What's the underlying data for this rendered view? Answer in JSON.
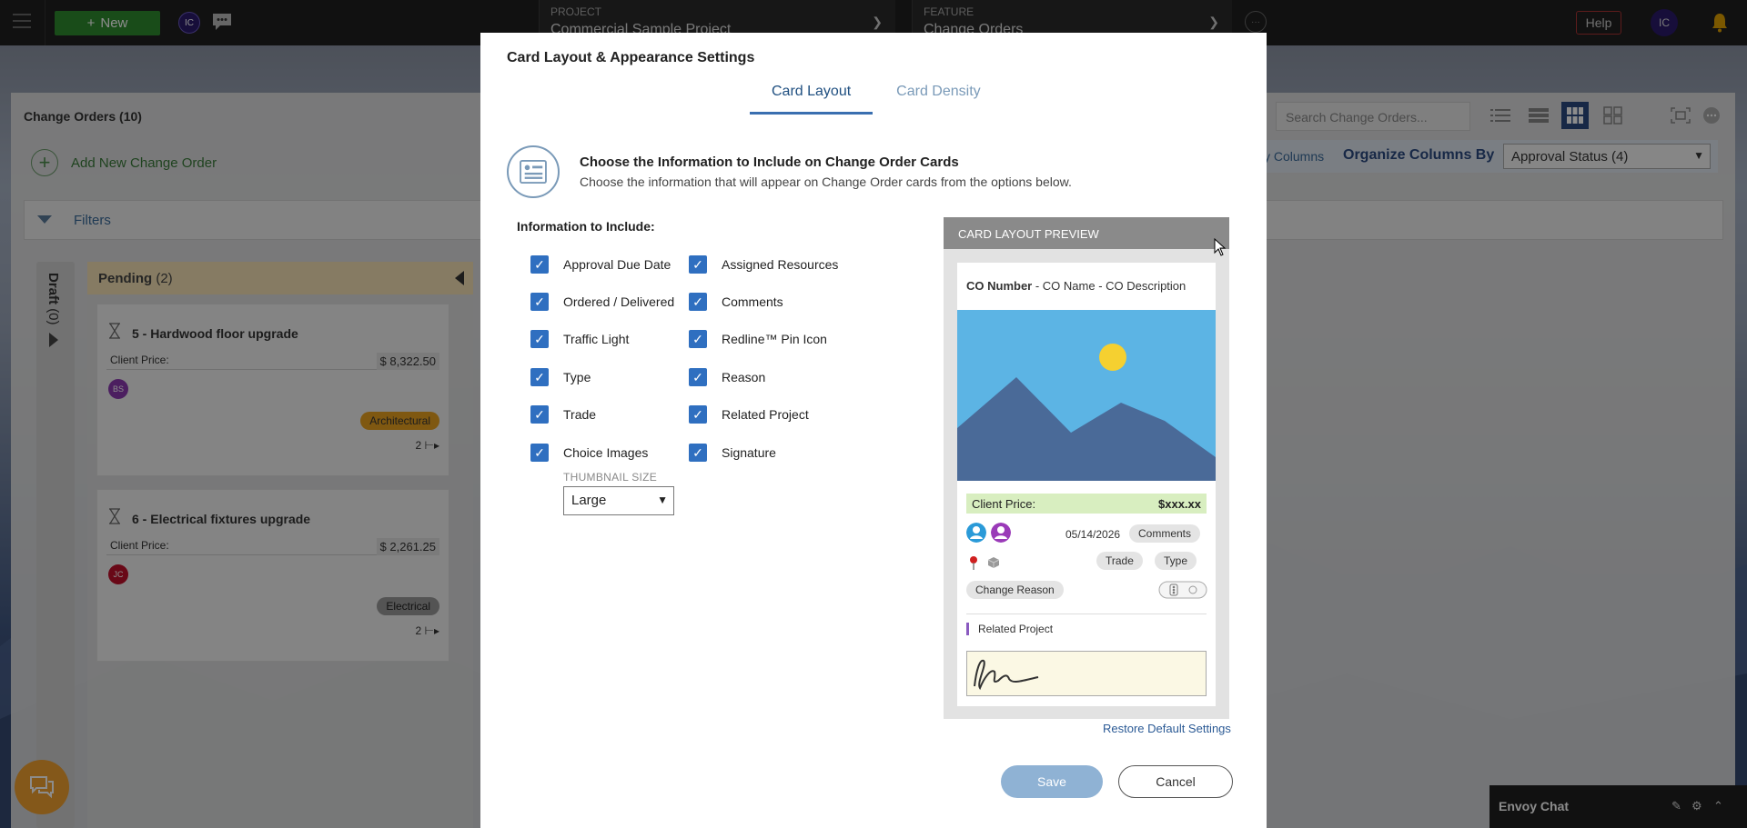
{
  "topbar": {
    "new_label": "New",
    "user_initials": "IC",
    "project": {
      "label": "PROJECT",
      "value": "Commercial Sample Project"
    },
    "feature": {
      "label": "FEATURE",
      "value": "Change Orders"
    },
    "more_label": "···",
    "help_label": "Help",
    "user_initials_right": "IC"
  },
  "main": {
    "title": "Change Orders (10)",
    "add_new_label": "Add New Change Order",
    "filters_label": "Filters",
    "search_placeholder": "Search Change Orders...",
    "quick_columns_label": "ity Columns",
    "organize_label": "Organize Columns By",
    "organize_value": "Approval Status (4)",
    "draft": {
      "name": "Draft",
      "count": "(0)"
    },
    "pending": {
      "name": "Pending",
      "count": "(2)"
    },
    "cards": [
      {
        "title": "5 - Hardwood floor upgrade",
        "price_label": "Client Price:",
        "price": "$ 8,322.50",
        "avatar": "BS",
        "tag": "Architectural",
        "count": "2"
      },
      {
        "title": "6 - Electrical fixtures upgrade",
        "price_label": "Client Price:",
        "price": "$ 2,261.25",
        "avatar": "JC",
        "tag": "Electrical",
        "count": "2"
      }
    ]
  },
  "envoy": {
    "title": "Envoy Chat"
  },
  "modal": {
    "title": "Card Layout & Appearance Settings",
    "tabs": [
      "Card Layout",
      "Card Density"
    ],
    "intro_heading": "Choose the Information to Include on Change Order Cards",
    "intro_text": "Choose the information that will appear on Change Order cards from the options below.",
    "info_label": "Information to Include:",
    "left_options": [
      "Approval Due Date",
      "Ordered / Delivered",
      "Traffic Light",
      "Type",
      "Trade",
      "Choice Images"
    ],
    "right_options": [
      "Assigned Resources",
      "Comments",
      "Redline™ Pin Icon",
      "Reason",
      "Related Project",
      "Signature"
    ],
    "checked": true,
    "thumbnail_label": "THUMBNAIL SIZE",
    "thumbnail_value": "Large",
    "preview": {
      "header": "CARD LAYOUT PREVIEW",
      "title_bold": "CO Number",
      "title_rest": " - CO Name - CO Description",
      "price_label": "Client Price:",
      "price_value": "$xxx.xx",
      "date": "05/14/2026",
      "comments": "Comments",
      "trade": "Trade",
      "type": "Type",
      "reason": "Change Reason",
      "related": "Related Project"
    },
    "restore_label": "Restore Default Settings",
    "save_label": "Save",
    "cancel_label": "Cancel"
  },
  "colors": {
    "accent": "#2f6fc0",
    "new_button": "#2e8b2e",
    "pending_header": "#f4e1b5"
  }
}
